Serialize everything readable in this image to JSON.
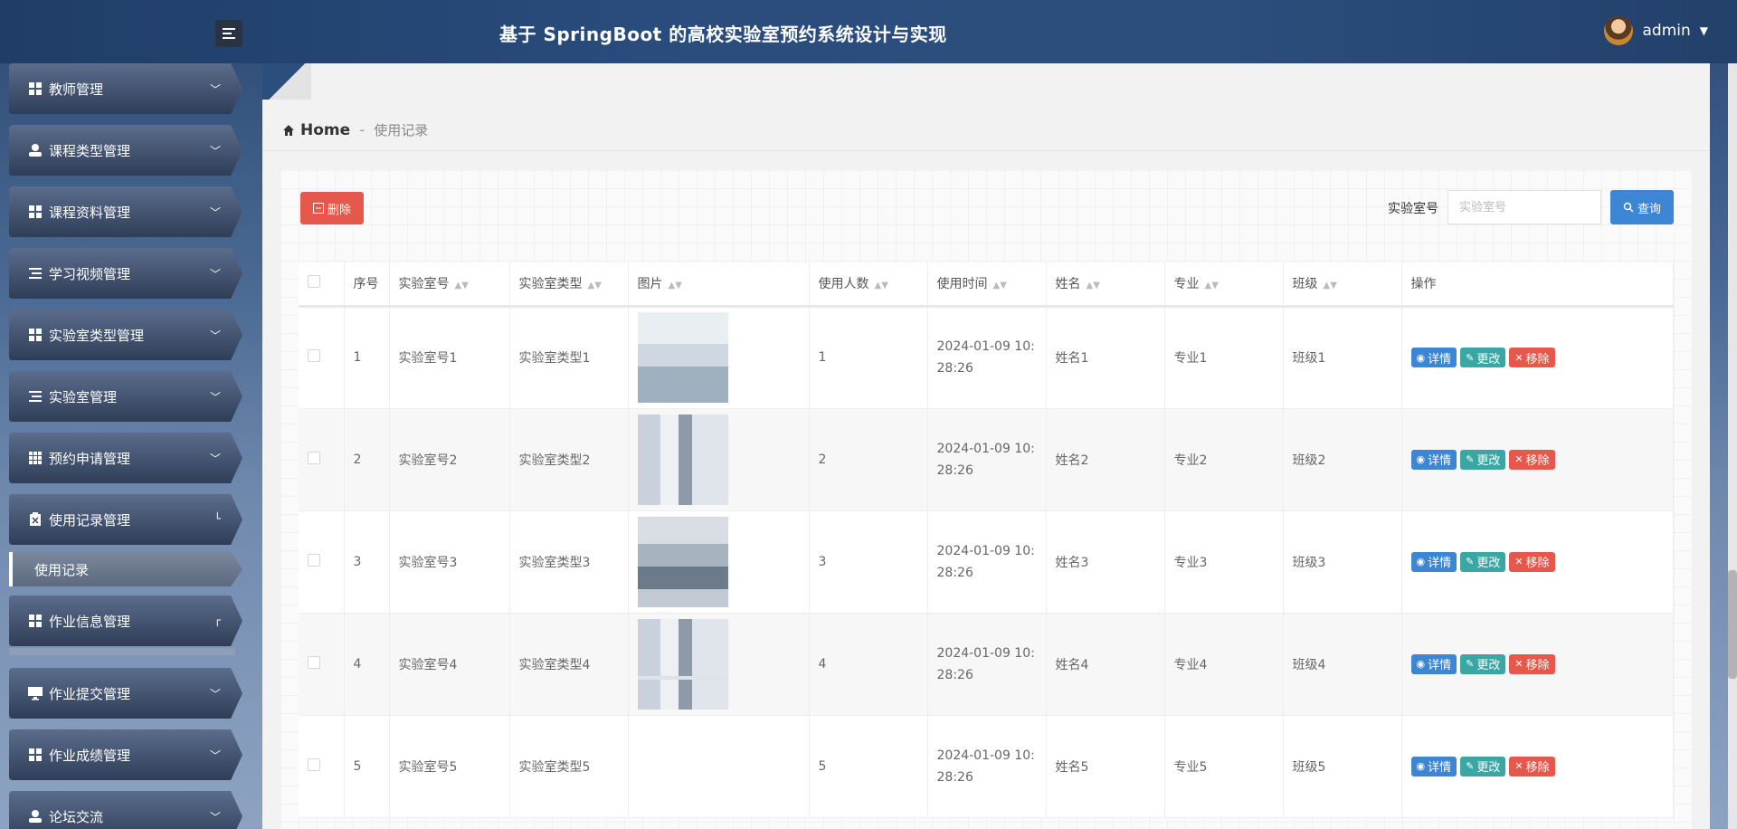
{
  "header": {
    "title": "基于 SpringBoot 的高校实验室预约系统设计与实现",
    "user": "admin"
  },
  "sidebar": {
    "items": [
      {
        "label": "教师管理",
        "icon": "grid-icon"
      },
      {
        "label": "课程类型管理",
        "icon": "user-icon"
      },
      {
        "label": "课程资料管理",
        "icon": "grid-icon"
      },
      {
        "label": "学习视频管理",
        "icon": "list-icon"
      },
      {
        "label": "实验室类型管理",
        "icon": "grid-icon"
      },
      {
        "label": "实验室管理",
        "icon": "list-icon"
      },
      {
        "label": "预约申请管理",
        "icon": "apps-icon"
      },
      {
        "label": "使用记录管理",
        "icon": "clipboard-icon"
      },
      {
        "label": "作业信息管理",
        "icon": "grid-icon"
      },
      {
        "label": "作业提交管理",
        "icon": "monitor-icon"
      },
      {
        "label": "作业成绩管理",
        "icon": "grid-icon"
      },
      {
        "label": "论坛交流",
        "icon": "user-icon"
      }
    ],
    "sub_item": "使用记录"
  },
  "breadcrumb": {
    "home": "Home",
    "separator": "-",
    "current": "使用记录"
  },
  "toolbar": {
    "delete_label": "删除",
    "search_label": "实验室号",
    "search_placeholder": "实验室号",
    "search_button": "查询"
  },
  "table": {
    "headers": [
      "序号",
      "实验室号",
      "实验室类型",
      "图片",
      "使用人数",
      "使用时间",
      "姓名",
      "专业",
      "班级",
      "操作"
    ],
    "actions": {
      "view": "详情",
      "edit": "更改",
      "delete": "移除"
    },
    "rows": [
      {
        "no": "1",
        "lab_no": "实验室号1",
        "lab_type": "实验室类型1",
        "count": "1",
        "time": "2024-01-09 10:28:26",
        "name": "姓名1",
        "major": "专业1",
        "cls": "班级1"
      },
      {
        "no": "2",
        "lab_no": "实验室号2",
        "lab_type": "实验室类型2",
        "count": "2",
        "time": "2024-01-09 10:28:26",
        "name": "姓名2",
        "major": "专业2",
        "cls": "班级2"
      },
      {
        "no": "3",
        "lab_no": "实验室号3",
        "lab_type": "实验室类型3",
        "count": "3",
        "time": "2024-01-09 10:28:26",
        "name": "姓名3",
        "major": "专业3",
        "cls": "班级3"
      },
      {
        "no": "4",
        "lab_no": "实验室号4",
        "lab_type": "实验室类型4",
        "count": "4",
        "time": "2024-01-09 10:28:26",
        "name": "姓名4",
        "major": "专业4",
        "cls": "班级4"
      },
      {
        "no": "5",
        "lab_no": "实验室号5",
        "lab_type": "实验室类型5",
        "count": "5",
        "time": "2024-01-09 10:28:26",
        "name": "姓名5",
        "major": "专业5",
        "cls": "班级5"
      }
    ]
  }
}
